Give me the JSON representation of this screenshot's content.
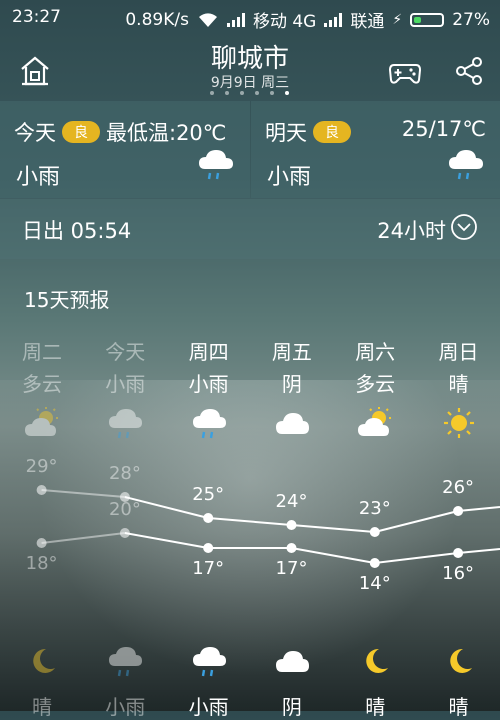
{
  "status": {
    "time": "23:27",
    "speed": "0.89K/s",
    "carrier1": "移动 4G",
    "carrier2": "联通",
    "battery": "27%"
  },
  "header": {
    "city": "聊城市",
    "date": "9月9日 周三",
    "page_count": 6,
    "active_page": 6
  },
  "today": {
    "label": "今天",
    "aqi": "良",
    "min_temp": "最低温:20℃",
    "condition": "小雨",
    "icon": "rain-cloud-icon"
  },
  "tomorrow": {
    "label": "明天",
    "aqi": "良",
    "range": "25/17℃",
    "condition": "小雨",
    "icon": "rain-cloud-icon"
  },
  "sunrise": {
    "text": "日出 05:54",
    "hours": "24小时"
  },
  "forecast": {
    "title": "15天预报",
    "days": [
      {
        "name": "周二",
        "day_cond": "多云",
        "day_icon": "partly-cloudy-icon",
        "high": "29°",
        "low": "18°",
        "night_icon": "moon-icon",
        "night_cond": "晴",
        "past": true
      },
      {
        "name": "今天",
        "day_cond": "小雨",
        "day_icon": "rain-cloud-icon",
        "high": "28°",
        "low": "20°",
        "night_icon": "rain-cloud-icon",
        "night_cond": "小雨",
        "past": true
      },
      {
        "name": "周四",
        "day_cond": "小雨",
        "day_icon": "rain-cloud-icon",
        "high": "25°",
        "low": "17°",
        "night_icon": "rain-cloud-icon",
        "night_cond": "小雨",
        "past": false
      },
      {
        "name": "周五",
        "day_cond": "阴",
        "day_icon": "cloud-icon",
        "high": "24°",
        "low": "17°",
        "night_icon": "cloud-icon",
        "night_cond": "阴",
        "past": false
      },
      {
        "name": "周六",
        "day_cond": "多云",
        "day_icon": "partly-cloudy-icon",
        "high": "23°",
        "low": "14°",
        "night_icon": "moon-icon",
        "night_cond": "晴",
        "past": false
      },
      {
        "name": "周日",
        "day_cond": "晴",
        "day_icon": "sun-icon",
        "high": "26°",
        "low": "16°",
        "night_icon": "moon-icon",
        "night_cond": "晴",
        "past": false
      }
    ]
  },
  "chart_data": {
    "type": "line",
    "categories": [
      "周二",
      "今天",
      "周四",
      "周五",
      "周六",
      "周日"
    ],
    "series": [
      {
        "values": [
          29,
          28,
          25,
          24,
          23,
          26
        ]
      },
      {
        "values": [
          18,
          20,
          17,
          17,
          14,
          16
        ]
      }
    ]
  }
}
